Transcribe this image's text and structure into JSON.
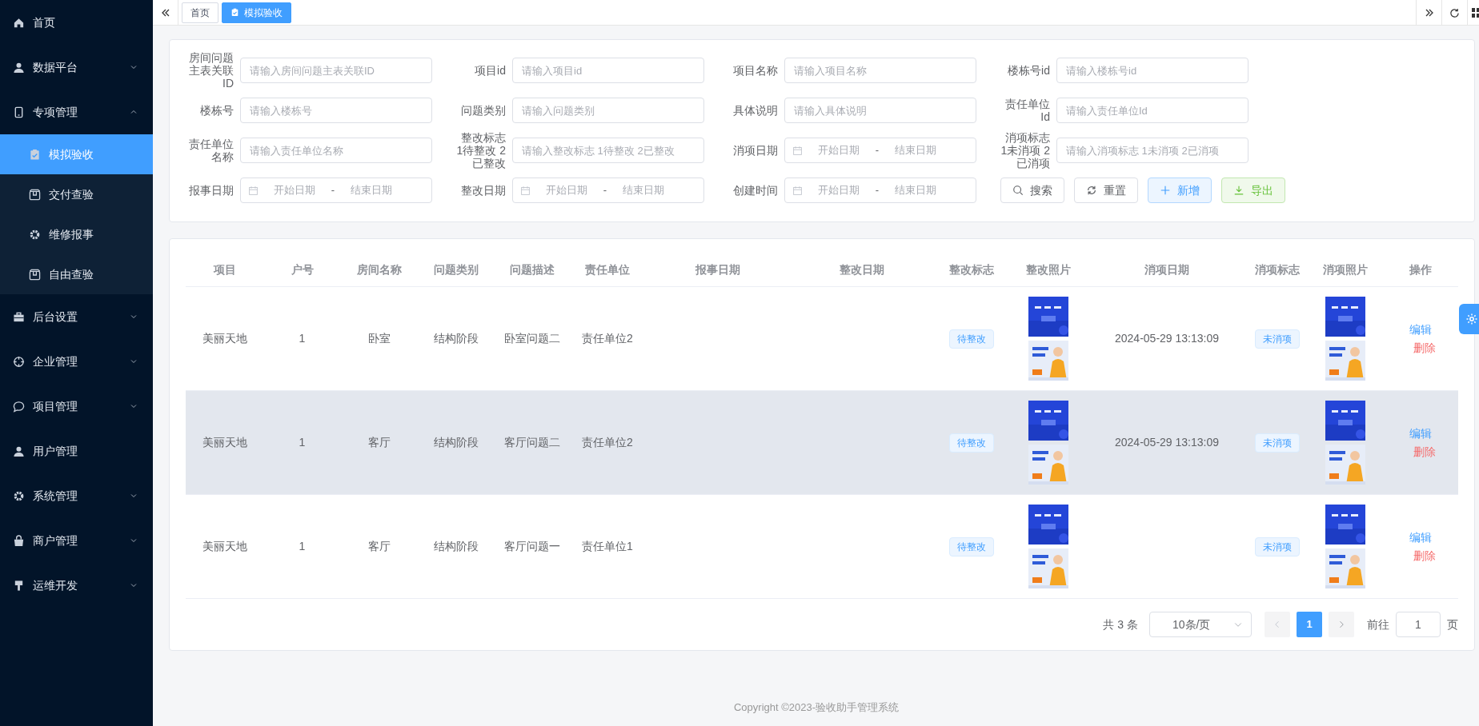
{
  "sidebar": {
    "items": [
      {
        "label": "首页",
        "kind": "link",
        "selected": false
      },
      {
        "label": "数据平台",
        "kind": "group",
        "expanded": false,
        "selected": false
      },
      {
        "label": "专项管理",
        "kind": "group",
        "expanded": true,
        "selected": false,
        "children": [
          {
            "label": "模拟验收",
            "selected": true
          },
          {
            "label": "交付查验",
            "selected": false
          },
          {
            "label": "维修报事",
            "selected": false
          },
          {
            "label": "自由查验",
            "selected": false
          }
        ]
      },
      {
        "label": "后台设置",
        "kind": "group",
        "expanded": false,
        "selected": false
      },
      {
        "label": "企业管理",
        "kind": "group",
        "expanded": false,
        "selected": false
      },
      {
        "label": "项目管理",
        "kind": "group",
        "expanded": false,
        "selected": false
      },
      {
        "label": "用户管理",
        "kind": "link",
        "selected": false
      },
      {
        "label": "系统管理",
        "kind": "group",
        "expanded": false,
        "selected": false
      },
      {
        "label": "商户管理",
        "kind": "group",
        "expanded": false,
        "selected": false
      },
      {
        "label": "运维开发",
        "kind": "group",
        "expanded": false,
        "selected": false
      }
    ]
  },
  "tabs": [
    {
      "label": "首页",
      "selected": false
    },
    {
      "label": "模拟验收",
      "selected": true
    }
  ],
  "filters": [
    {
      "label": "房间问题主表关联ID",
      "kind": "text",
      "placeholder": "请输入房间问题主表关联ID"
    },
    {
      "label": "项目id",
      "kind": "text",
      "placeholder": "请输入项目id"
    },
    {
      "label": "项目名称",
      "kind": "text",
      "placeholder": "请输入项目名称"
    },
    {
      "label": "楼栋号id",
      "kind": "text",
      "placeholder": "请输入楼栋号id"
    },
    {
      "label": "楼栋号",
      "kind": "text",
      "placeholder": "请输入楼栋号"
    },
    {
      "label": "问题类别",
      "kind": "text",
      "placeholder": "请输入问题类别"
    },
    {
      "label": "具体说明",
      "kind": "text",
      "placeholder": "请输入具体说明"
    },
    {
      "label": "责任单位Id",
      "kind": "text",
      "placeholder": "请输入责任单位Id"
    },
    {
      "label": "责任单位名称",
      "kind": "text",
      "placeholder": "请输入责任单位名称"
    },
    {
      "label": "整改标志 1待整改 2已整改",
      "kind": "text",
      "placeholder": "请输入整改标志 1待整改 2已整改"
    },
    {
      "label": "消项日期",
      "kind": "daterange",
      "start_placeholder": "开始日期",
      "separator": "-",
      "end_placeholder": "结束日期"
    },
    {
      "label": "消项标志 1未消项 2已消项",
      "kind": "text",
      "placeholder": "请输入消项标志 1未消项 2已消项"
    },
    {
      "label": "报事日期",
      "kind": "daterange",
      "start_placeholder": "开始日期",
      "separator": "-",
      "end_placeholder": "结束日期"
    },
    {
      "label": "整改日期",
      "kind": "daterange",
      "start_placeholder": "开始日期",
      "separator": "-",
      "end_placeholder": "结束日期"
    },
    {
      "label": "创建时间",
      "kind": "daterange",
      "start_placeholder": "开始日期",
      "separator": "-",
      "end_placeholder": "结束日期"
    }
  ],
  "buttons": [
    {
      "label": "搜索",
      "kind": "search"
    },
    {
      "label": "重置",
      "kind": "reset"
    },
    {
      "label": "新增",
      "kind": "add"
    },
    {
      "label": "导出",
      "kind": "export"
    }
  ],
  "table": {
    "columns": [
      "项目",
      "户号",
      "房间名称",
      "问题类别",
      "问题描述",
      "责任单位",
      "报事日期",
      "整改日期",
      "整改标志",
      "整改照片",
      "消项日期",
      "消项标志",
      "消项照片",
      "操作"
    ],
    "rows": [
      {
        "highlighted": false,
        "project": "美丽天地",
        "unit": "1",
        "room": "卧室",
        "category": "结构阶段",
        "description": "卧室问题二",
        "responsible": "责任单位2",
        "rectify_flag": "待整改",
        "rectify_photos": [
          {
            "kind": "picture"
          },
          {
            "kind": "picture"
          }
        ],
        "clear_date": "2024-05-29 13:13:09",
        "clear_flag": "未消项",
        "clear_photos": [
          {
            "kind": "picture"
          },
          {
            "kind": "picture"
          }
        ],
        "actions": [
          {
            "label": "编辑",
            "kind": "edit"
          },
          {
            "label": "删除",
            "kind": "delete"
          }
        ]
      },
      {
        "highlighted": true,
        "project": "美丽天地",
        "unit": "1",
        "room": "客厅",
        "category": "结构阶段",
        "description": "客厅问题二",
        "responsible": "责任单位2",
        "rectify_flag": "待整改",
        "rectify_photos": [
          {
            "kind": "picture"
          },
          {
            "kind": "picture"
          }
        ],
        "clear_date": "2024-05-29 13:13:09",
        "clear_flag": "未消项",
        "clear_photos": [
          {
            "kind": "picture"
          },
          {
            "kind": "picture"
          }
        ],
        "actions": [
          {
            "label": "编辑",
            "kind": "edit"
          },
          {
            "label": "删除",
            "kind": "delete"
          }
        ]
      },
      {
        "highlighted": false,
        "project": "美丽天地",
        "unit": "1",
        "room": "客厅",
        "category": "结构阶段",
        "description": "客厅问题一",
        "responsible": "责任单位1",
        "rectify_flag": "待整改",
        "rectify_photos": [
          {
            "kind": "picture"
          },
          {
            "kind": "picture"
          }
        ],
        "clear_flag": "未消项",
        "clear_photos": [
          {
            "kind": "picture"
          },
          {
            "kind": "picture"
          }
        ],
        "actions": [
          {
            "label": "编辑",
            "kind": "edit"
          },
          {
            "label": "删除",
            "kind": "delete"
          }
        ]
      }
    ]
  },
  "pagination": {
    "total": "共 3 条",
    "page_size": "10条/页",
    "pages": [
      {
        "label": "1",
        "selected": true
      }
    ],
    "prev_disabled": true,
    "goto_label": "前往",
    "goto_value": "1",
    "page_suffix": "页"
  },
  "footer": "Copyright ©2023-验收助手管理系统"
}
